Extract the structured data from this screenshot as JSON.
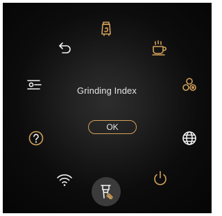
{
  "dialog": {
    "title": "Grinding Index",
    "ok_label": "OK"
  },
  "ring_icons": [
    "grinder-icon",
    "coffee-cup-icon",
    "product-selection-icon",
    "globe-icon",
    "power-icon",
    "grinding-index-icon",
    "wifi-icon",
    "help-icon",
    "settings-slider-icon",
    "back-arrow-icon"
  ],
  "selected_icon": "grinding-index-icon",
  "colors": {
    "accent": "#d4a15a",
    "text": "#e6e6e6",
    "selected_background": "#3b3b3b",
    "background": "#0c0c0c"
  }
}
